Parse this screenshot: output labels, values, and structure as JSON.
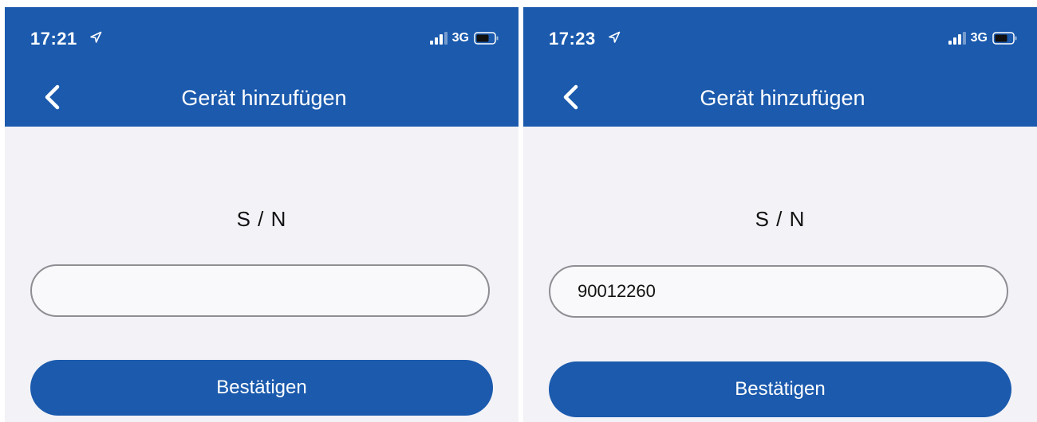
{
  "colors": {
    "accent": "#1b5aad",
    "content_background": "#f2f2f7",
    "field_border": "#8e8e93"
  },
  "screens": [
    {
      "status_bar": {
        "time": "17:21",
        "network": "3G",
        "icons": [
          "location-arrow-icon",
          "signal-bars-icon",
          "battery-icon"
        ]
      },
      "nav": {
        "back_icon": "chevron-left-icon",
        "title": "Gerät hinzufügen"
      },
      "serial_label": "S / N",
      "serial_input": {
        "value": ""
      },
      "confirm_label": "Bestätigen"
    },
    {
      "status_bar": {
        "time": "17:23",
        "network": "3G",
        "icons": [
          "location-arrow-icon",
          "signal-bars-icon",
          "battery-icon"
        ]
      },
      "nav": {
        "back_icon": "chevron-left-icon",
        "title": "Gerät hinzufügen"
      },
      "serial_label": "S / N",
      "serial_input": {
        "value": "90012260"
      },
      "confirm_label": "Bestätigen"
    }
  ]
}
